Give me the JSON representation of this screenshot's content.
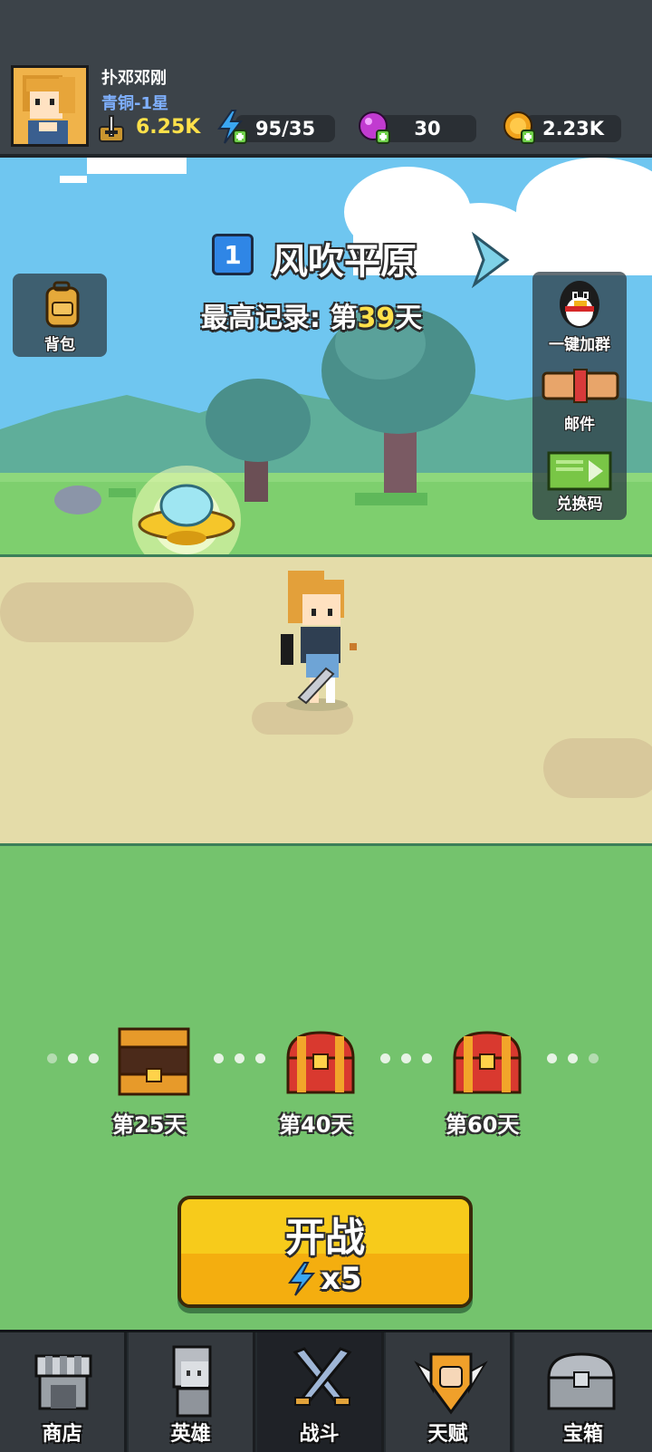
{
  "player": {
    "name": "扑邓邓刚",
    "rank": "青铜-1星"
  },
  "resources": {
    "power": "6.25K",
    "energy": "95/35",
    "gems": "30",
    "coins": "2.23K"
  },
  "stage": {
    "number": "1",
    "name": "风吹平原",
    "record_prefix": "最高记录: 第",
    "record_day": "39",
    "record_suffix": "天"
  },
  "side_left": {
    "backpack": "背包"
  },
  "side_right": {
    "join_group": "一键加群",
    "mail": "邮件",
    "redeem": "兑换码"
  },
  "rewards": [
    {
      "label": "第25天",
      "state": "opened"
    },
    {
      "label": "第40天",
      "state": "closed"
    },
    {
      "label": "第60天",
      "state": "closed"
    }
  ],
  "start": {
    "label": "开战",
    "cost": "x5"
  },
  "nav": [
    {
      "label": "商店",
      "icon": "shop-icon"
    },
    {
      "label": "英雄",
      "icon": "hero-icon"
    },
    {
      "label": "战斗",
      "icon": "crossed-swords-icon",
      "active": true
    },
    {
      "label": "天赋",
      "icon": "fist-shield-icon"
    },
    {
      "label": "宝箱",
      "icon": "treasure-chest-icon"
    }
  ],
  "colors": {
    "accent_yellow": "#f7cb1b",
    "record_highlight": "#ffe14a",
    "grass": "#74c36d",
    "sky": "#6fc6f0"
  }
}
